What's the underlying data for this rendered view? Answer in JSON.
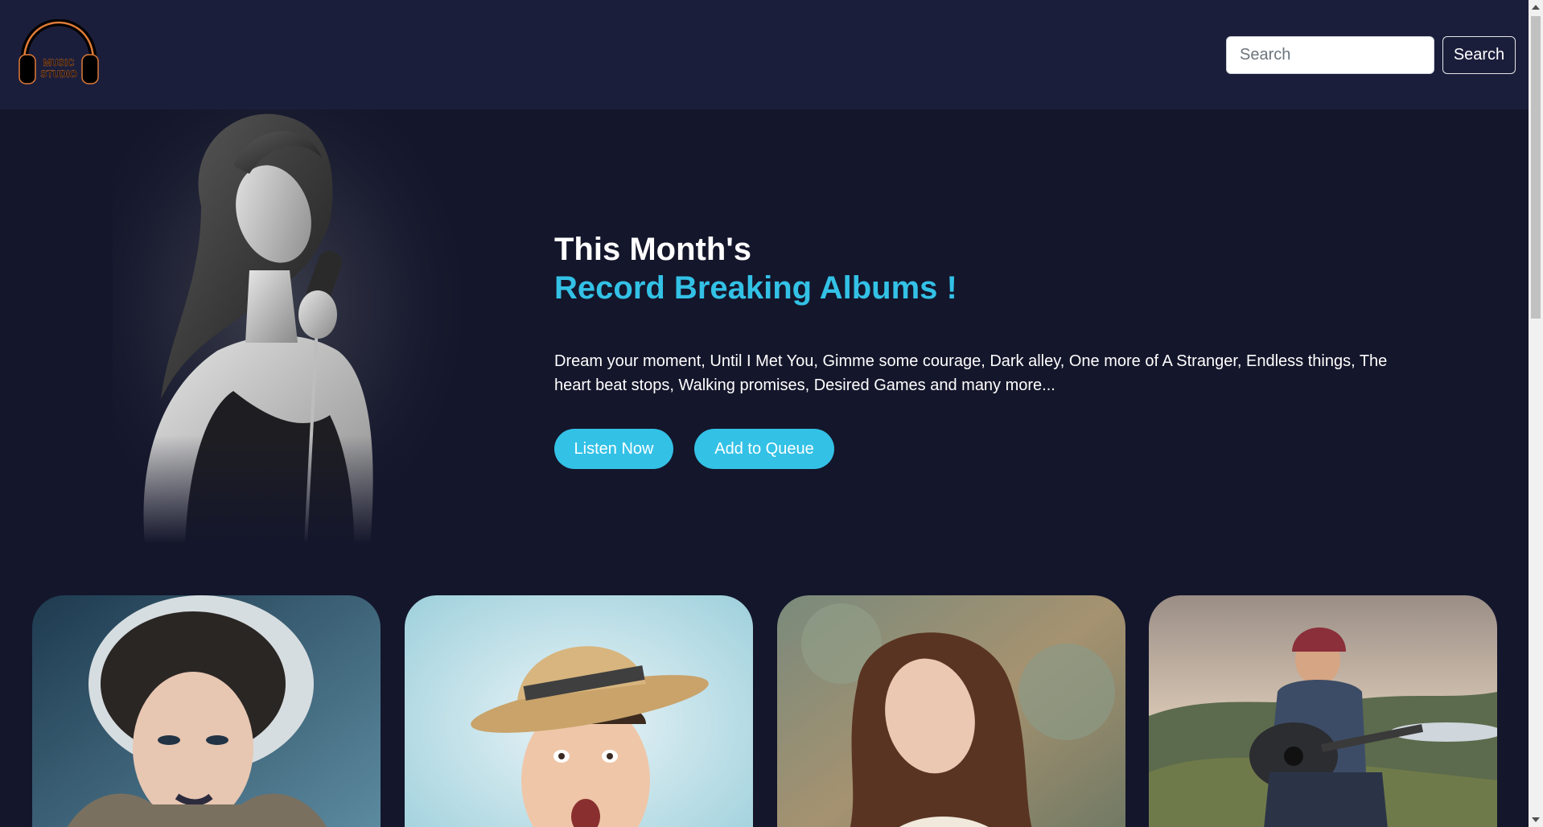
{
  "header": {
    "logo_text_line1": "MUSIC",
    "logo_text_line2": "STUDIO",
    "search_placeholder": "Search",
    "search_button_label": "Search"
  },
  "hero": {
    "title_line1": "This Month's",
    "title_line2": "Record Breaking Albums !",
    "description": "Dream your moment, Until I Met You, Gimme some courage, Dark alley, One more of A Stranger, Endless things, The heart beat stops, Walking promises, Desired Games and many more...",
    "listen_button_label": "Listen Now",
    "queue_button_label": "Add to Queue"
  },
  "cards": [
    {
      "subject": "woman in fur hood"
    },
    {
      "subject": "surprised man in straw hat"
    },
    {
      "subject": "woman with long hair outdoors"
    },
    {
      "subject": "man playing guitar on mountain"
    }
  ],
  "colors": {
    "navbar_bg": "#1b1e3b",
    "page_bg": "#14162b",
    "accent": "#33c1e6",
    "logo_orange": "#e07b39"
  },
  "icons": {
    "logo": "headphones-icon",
    "scroll_up": "triangle-up-icon",
    "scroll_down": "triangle-down-icon"
  }
}
